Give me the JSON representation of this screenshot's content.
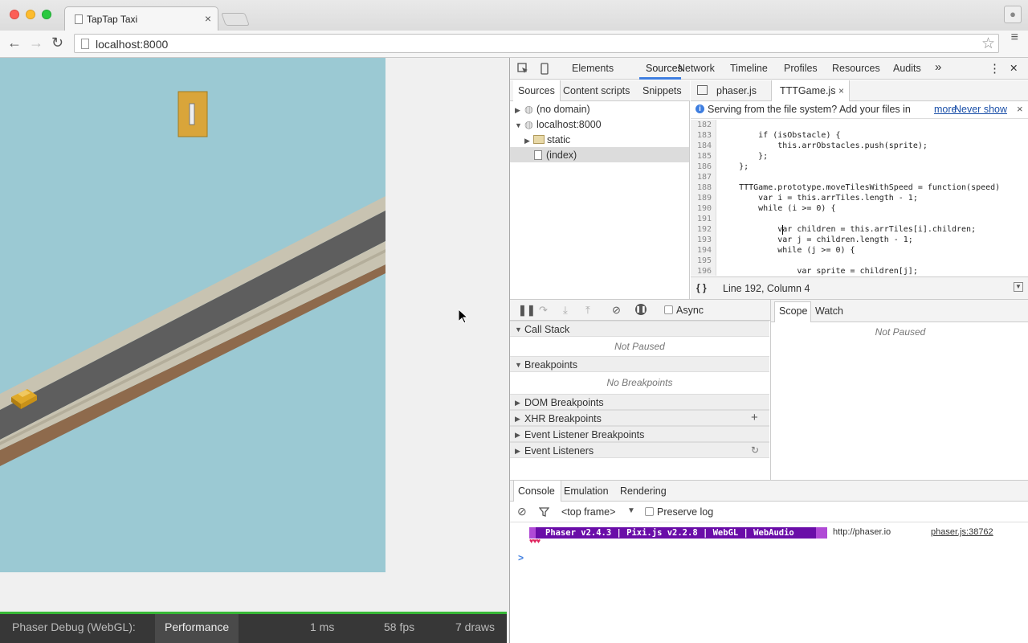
{
  "browser": {
    "tab_title": "TapTap Taxi",
    "tab_close": "×",
    "url": "localhost:8000",
    "back_icon": "←",
    "forward_icon": "→",
    "reload_icon": "↻",
    "star_icon": "☆",
    "menu_icon": "≡",
    "profile_icon": "👤"
  },
  "debug_bar": {
    "label": "Phaser Debug (WebGL):",
    "tab": "Performance",
    "ms": "1 ms",
    "fps": "58 fps",
    "draws": "7 draws"
  },
  "devtools": {
    "tabs": [
      "Elements",
      "Sources",
      "Network",
      "Timeline",
      "Profiles",
      "Resources",
      "Audits"
    ],
    "active_tab": "Sources",
    "more_icon": "»",
    "kebab_icon": "⋮",
    "close_icon": "✕",
    "navigator": {
      "tabs": [
        "Sources",
        "Content scripts",
        "Snippets"
      ],
      "tree": {
        "no_domain": "(no domain)",
        "host": "localhost:8000",
        "folder": "static",
        "file": "(index)"
      }
    },
    "editor": {
      "tabs": [
        "phaser.js",
        "TTTGame.js"
      ],
      "active_tab": "TTTGame.js",
      "info": "Serving from the file system? Add your files in",
      "info_link_more": "more",
      "info_link_never": "Never show",
      "line_numbers": [
        "182",
        "183",
        "184",
        "185",
        "186",
        "187",
        "188",
        "189",
        "190",
        "191",
        "192",
        "193",
        "194",
        "195",
        "196"
      ],
      "code_lines": [
        "",
        "        if (isObstacle) {",
        "            this.arrObstacles.push(sprite);",
        "        };",
        "    };",
        "",
        "    TTTGame.prototype.moveTilesWithSpeed = function(speed)",
        "        var i = this.arrTiles.length - 1;",
        "        while (i >= 0) {",
        "",
        "            var children = this.arrTiles[i].children;",
        "            var j = children.length - 1;",
        "            while (j >= 0) {",
        "",
        "                var sprite = children[j];"
      ],
      "status": "Line 192, Column 4",
      "pretty_icon": "{ }"
    },
    "debugger": {
      "async_label": "Async",
      "sections": {
        "call_stack": "Call Stack",
        "call_stack_msg": "Not Paused",
        "breakpoints": "Breakpoints",
        "breakpoints_msg": "No Breakpoints",
        "dom_breakpoints": "DOM Breakpoints",
        "xhr_breakpoints": "XHR Breakpoints",
        "event_listener_breakpoints": "Event Listener Breakpoints",
        "event_listeners": "Event Listeners"
      },
      "sidebar_tabs": [
        "Scope",
        "Watch"
      ],
      "scope_msg": "Not Paused"
    },
    "console": {
      "tabs": [
        "Console",
        "Emulation",
        "Rendering"
      ],
      "frame": "<top frame>",
      "preserve_log": "Preserve log",
      "banner": "Phaser v2.4.3 | Pixi.js v2.2.8 | WebGL | WebAudio",
      "url": "http://phaser.io",
      "source": "phaser.js:38762",
      "hearts": "♥♥♥",
      "prompt": ">"
    }
  },
  "colors": {
    "game_bg": "#9bc9d3",
    "road": "#5e5e5e",
    "road_edge": "#c8c3b1",
    "dirt": "#8e6a4c",
    "phaser_purple": "#6a0da8",
    "accent_blue": "#3e7ee0"
  }
}
